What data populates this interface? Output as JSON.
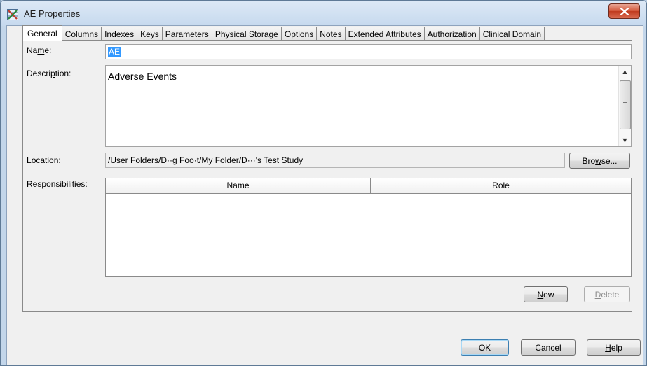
{
  "window": {
    "title": "AE Properties",
    "title_icon": "table-x-icon",
    "close_icon": "close-icon"
  },
  "tabs": [
    {
      "label": "General",
      "active": true
    },
    {
      "label": "Columns"
    },
    {
      "label": "Indexes"
    },
    {
      "label": "Keys"
    },
    {
      "label": "Parameters"
    },
    {
      "label": "Physical Storage"
    },
    {
      "label": "Options"
    },
    {
      "label": "Notes"
    },
    {
      "label": "Extended Attributes"
    },
    {
      "label": "Authorization"
    },
    {
      "label": "Clinical Domain"
    }
  ],
  "general": {
    "name_label_pre": "Na",
    "name_label_key": "m",
    "name_label_post": "e:",
    "name_value": "AE",
    "description_label_pre": "Descri",
    "description_label_key": "p",
    "description_label_post": "tion:",
    "description_value": "Adverse Events",
    "location_label_key": "L",
    "location_label_post": "ocation:",
    "location_value": "/User Folders/D··g Foo·t/My Folder/D···'s Test Study",
    "browse_pre": "Bro",
    "browse_key": "w",
    "browse_post": "se...",
    "responsibilities_label_key": "R",
    "responsibilities_label_post": "esponsibilities:",
    "responsibilities_columns": [
      "Name",
      "Role"
    ],
    "new_key": "N",
    "new_post": "ew",
    "delete_label_key": "D",
    "delete_label_post": "elete"
  },
  "footer": {
    "ok_label": "OK",
    "cancel_label": "Cancel",
    "help_key": "H",
    "help_post": "elp"
  },
  "colors": {
    "selection": "#3399ff",
    "close_button": "#c94a2e"
  }
}
